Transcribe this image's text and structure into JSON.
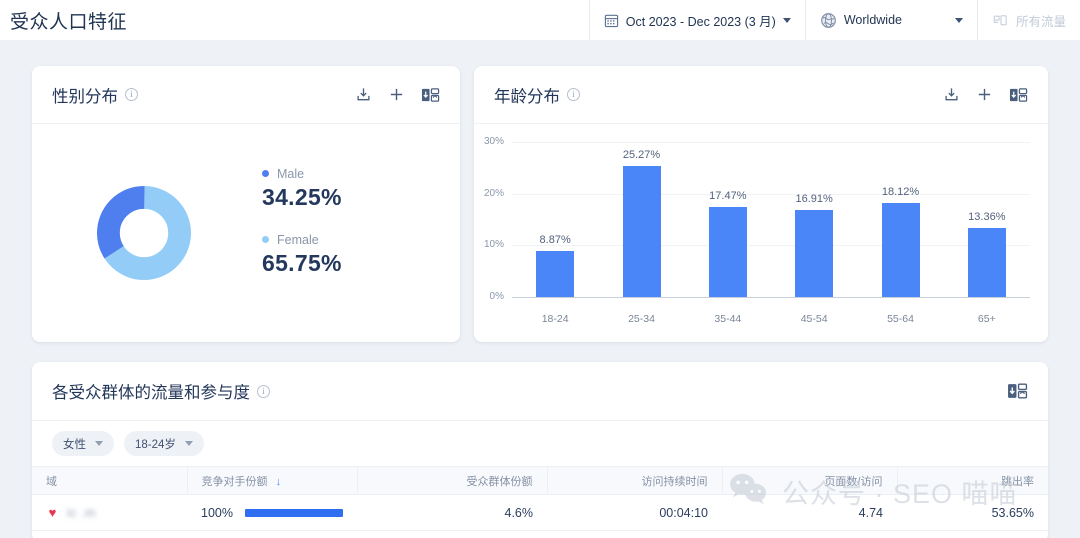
{
  "header": {
    "title": "受众人口特征",
    "date_range": "Oct 2023 - Dec 2023 (3 月)",
    "region": "Worldwide",
    "traffic": "所有流量",
    "calendar_icon": "calendar-icon",
    "globe_icon": "globe-icon",
    "device_icon": "device-icon"
  },
  "gender_card": {
    "title": "性别分布",
    "info_icon": "info-icon",
    "actions": [
      "export-icon",
      "plus-icon",
      "pdf-export-icon"
    ],
    "legend": [
      {
        "name": "Male",
        "value": "34.25%",
        "color": "#4f7fee"
      },
      {
        "name": "Female",
        "value": "65.75%",
        "color": "#93cdf7"
      }
    ]
  },
  "age_card": {
    "title": "年龄分布",
    "info_icon": "info-icon",
    "actions": [
      "export-icon",
      "plus-icon",
      "pdf-export-icon"
    ]
  },
  "table_card": {
    "title": "各受众群体的流量和参与度",
    "info_icon": "info-icon",
    "actions": [
      "pdf-export-icon"
    ],
    "chips": [
      {
        "label": "女性"
      },
      {
        "label": "18-24岁"
      }
    ],
    "columns": [
      {
        "label": "域",
        "align": "left"
      },
      {
        "label": "竞争对手份额",
        "align": "left",
        "sort": "↓"
      },
      {
        "label": "受众群体份额",
        "align": "right"
      },
      {
        "label": "访问持续时间",
        "align": "right"
      },
      {
        "label": "页面数/访问",
        "align": "right"
      },
      {
        "label": "跳出率",
        "align": "right"
      }
    ],
    "rows": [
      {
        "domain": "ic          .m",
        "favicon": "heart-favicon",
        "competitor_share": "100%",
        "competitor_share_pct": 100,
        "audience_share": "4.6%",
        "visit_duration": "00:04:10",
        "pages_per_visit": "4.74",
        "bounce_rate": "53.65%"
      }
    ]
  },
  "watermark": {
    "text": "公众号 · SEO 喵喵",
    "icon": "wechat-icon"
  },
  "chart_data": [
    {
      "type": "pie",
      "title": "性别分布",
      "labels": [
        "Male",
        "Female"
      ],
      "values": [
        34.25,
        65.75
      ],
      "colors": [
        "#4f7fee",
        "#93cdf7"
      ],
      "unit": "%",
      "legend": "right",
      "donut": true
    },
    {
      "type": "bar",
      "title": "年龄分布",
      "categories": [
        "18-24",
        "25-34",
        "35-44",
        "45-54",
        "55-64",
        "65+"
      ],
      "values": [
        8.87,
        25.27,
        17.47,
        16.91,
        18.12,
        13.36
      ],
      "labels": [
        "8.87%",
        "25.27%",
        "17.47%",
        "16.91%",
        "18.12%",
        "13.36%"
      ],
      "yticks": [
        0,
        10,
        20,
        30
      ],
      "yticklabels": [
        "0%",
        "10%",
        "20%",
        "30%"
      ],
      "ylim": [
        0,
        30
      ],
      "xlabel": "",
      "ylabel": "",
      "grid": true,
      "color": "#4a86f7"
    }
  ]
}
